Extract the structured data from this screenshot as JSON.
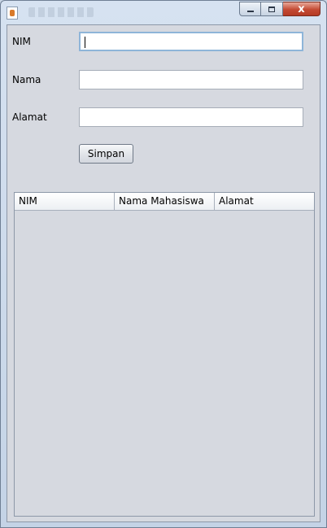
{
  "window": {
    "minimize_glyph": "",
    "maximize_glyph": "",
    "close_glyph": "x"
  },
  "form": {
    "nim_label": "NIM",
    "nim_value": "",
    "nama_label": "Nama",
    "nama_value": "",
    "alamat_label": "Alamat",
    "alamat_value": "",
    "submit_label": "Simpan"
  },
  "table": {
    "columns": [
      "NIM",
      "Nama Mahasiswa",
      "Alamat"
    ],
    "rows": []
  },
  "icons": {
    "app": "java-app-icon",
    "minimize": "minimize-icon",
    "maximize": "maximize-icon",
    "close": "close-icon"
  }
}
